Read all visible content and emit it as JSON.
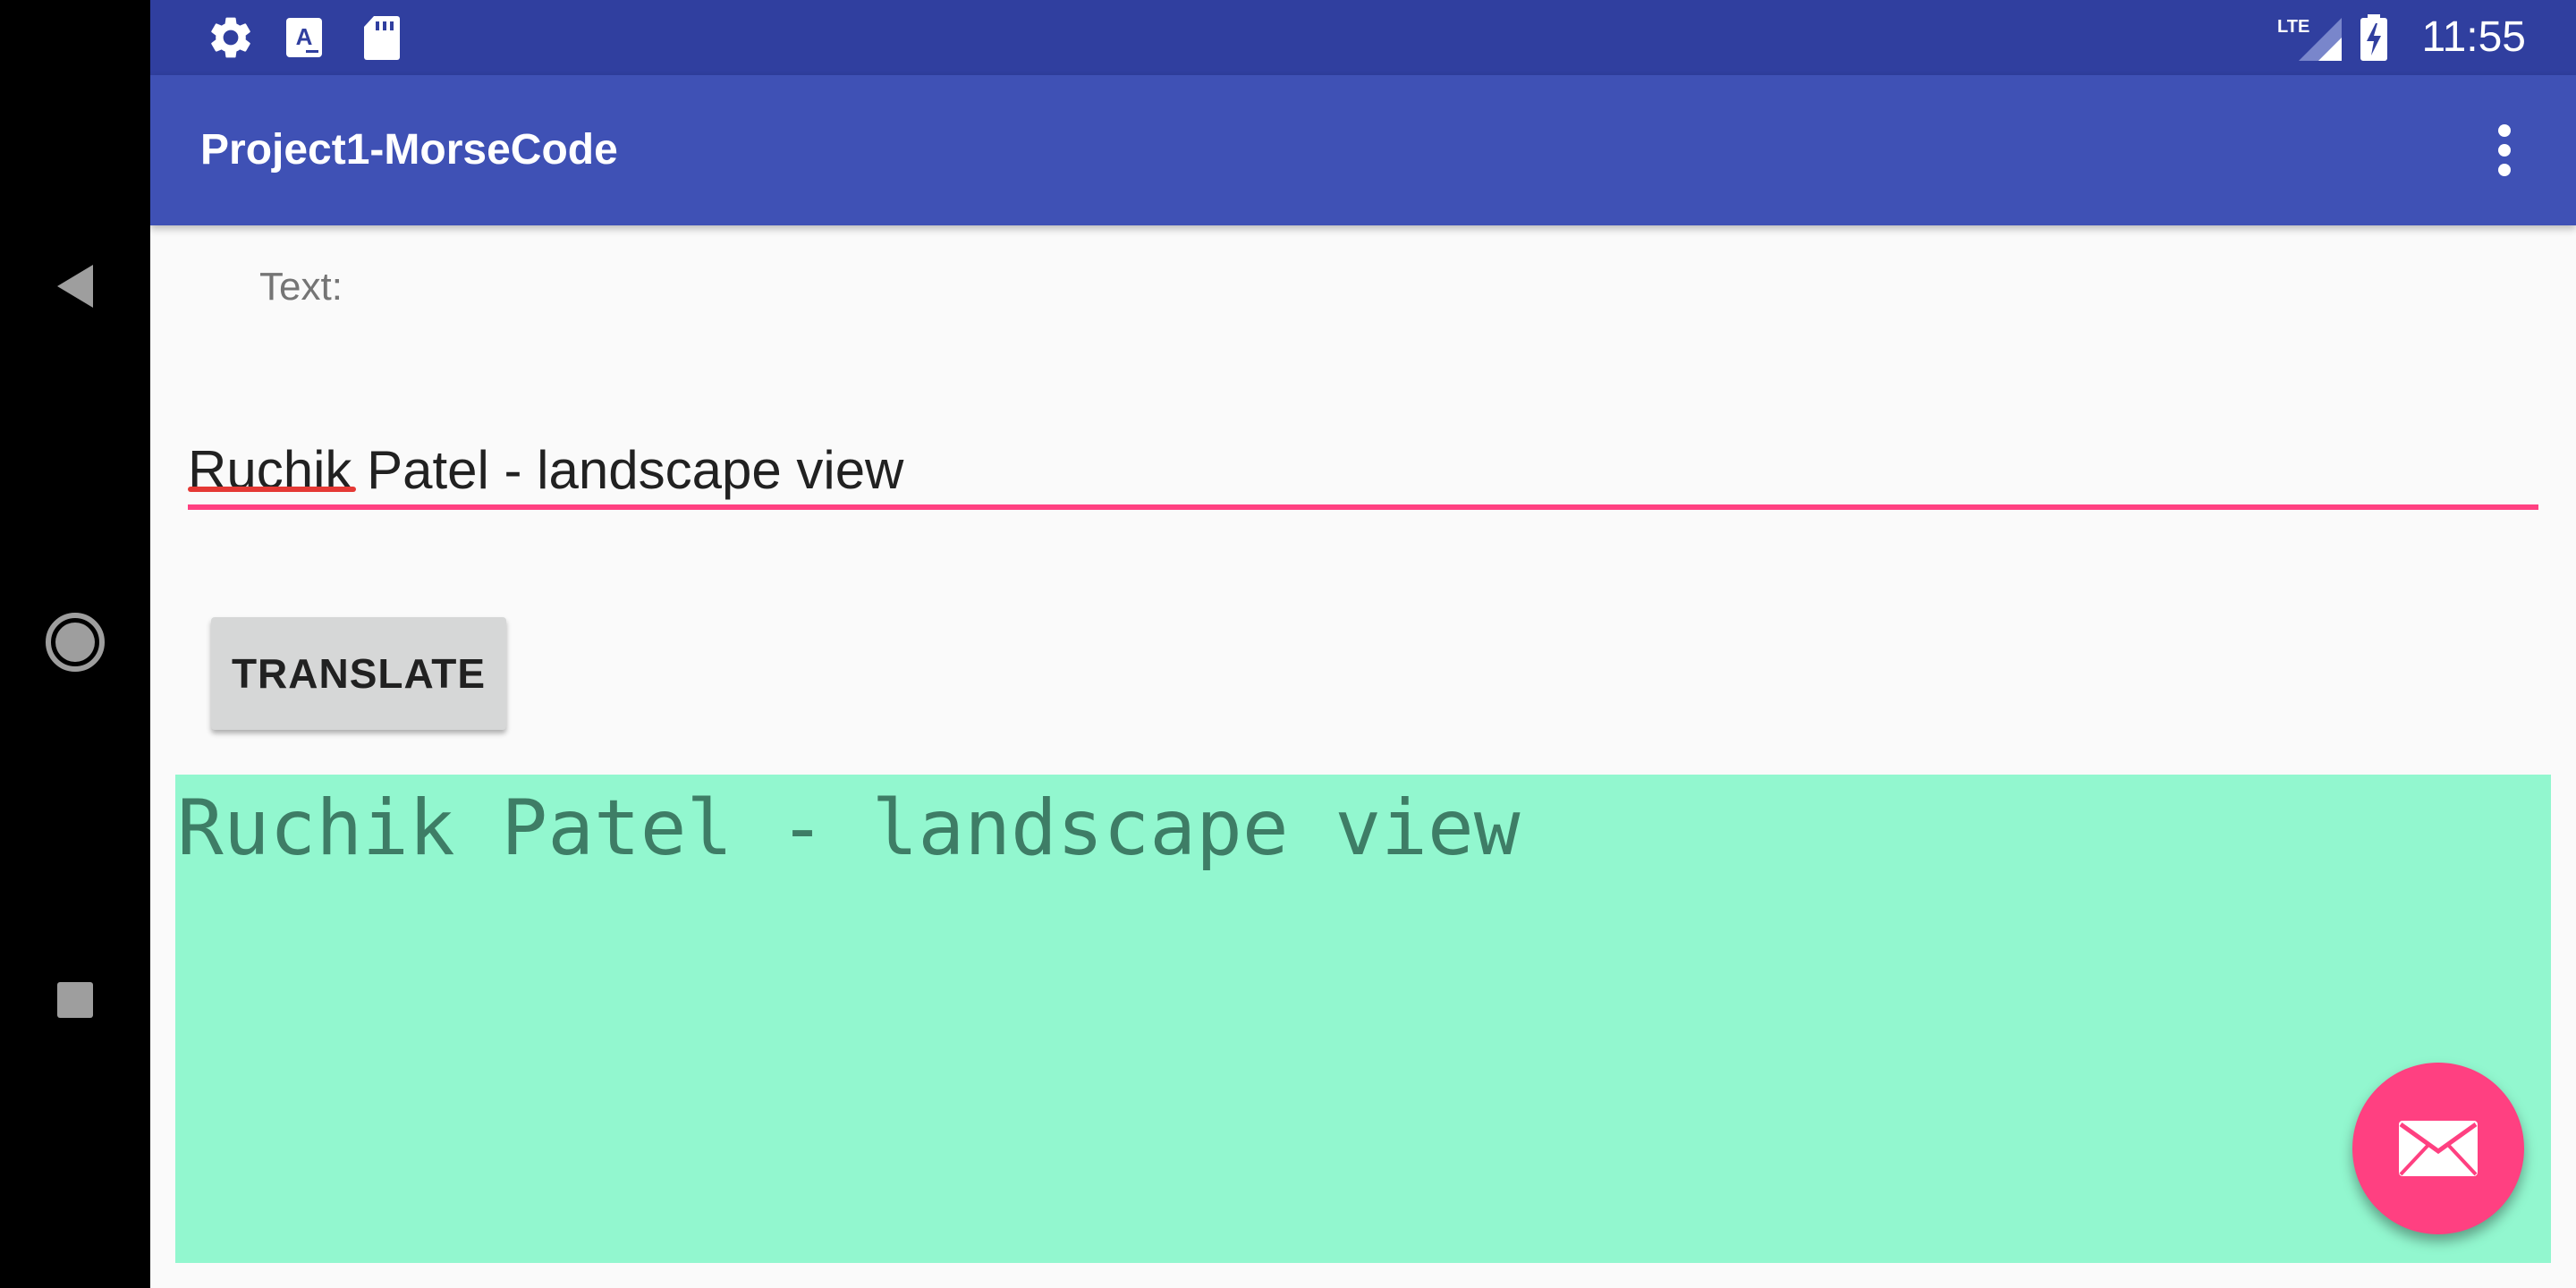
{
  "status_bar": {
    "time": "11:55",
    "network_label": "LTE",
    "icons": [
      "settings-icon",
      "font-a-icon",
      "sd-card-icon",
      "lte-signal-icon",
      "battery-charging-icon"
    ]
  },
  "app_bar": {
    "title": "Project1-MorseCode",
    "menu_icon": "more-vert-icon"
  },
  "form": {
    "label": "Text:",
    "input_value": "Ruchik Patel - landscape view",
    "translate_label": "TRANSLATE"
  },
  "output": {
    "text": "Ruchik Patel - landscape view"
  },
  "fab": {
    "icon": "mail-icon"
  },
  "navigation": {
    "icons": [
      "back-icon",
      "home-icon",
      "recents-icon"
    ]
  },
  "colors": {
    "status_bar": "#303f9f",
    "app_bar": "#3f51b5",
    "accent": "#ff4081",
    "output_bg": "#92f7cf",
    "output_text": "#3e7d66"
  }
}
